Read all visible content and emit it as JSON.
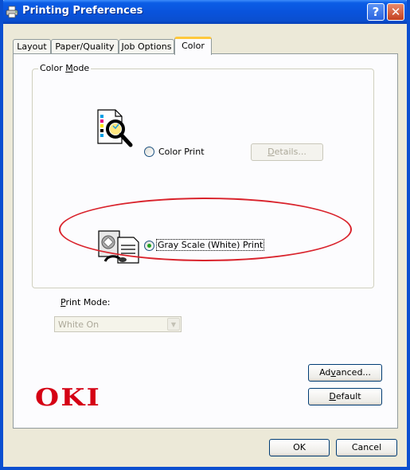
{
  "window": {
    "title": "Printing Preferences",
    "help_glyph": "?",
    "close_glyph": "✕"
  },
  "tabs": [
    {
      "label": "Layout"
    },
    {
      "label": "Paper/Quality"
    },
    {
      "label": "Job Options"
    },
    {
      "label": "Color",
      "active": true
    }
  ],
  "color_mode": {
    "group_label_pre": "Color ",
    "group_label_ul": "M",
    "group_label_post": "ode",
    "color_print": {
      "label": "Color Print",
      "checked": false
    },
    "details_button": {
      "pre": "",
      "ul": "D",
      "post": "etails...",
      "enabled": false
    },
    "grayscale_print": {
      "label": "Gray Scale (White) Print",
      "checked": true
    }
  },
  "print_mode": {
    "label_ul": "P",
    "label_post": "rint Mode:",
    "selected": "White On",
    "enabled": false
  },
  "buttons": {
    "advanced": {
      "pre": "Ad",
      "ul": "v",
      "post": "anced..."
    },
    "default": {
      "pre": "",
      "ul": "D",
      "post": "efault"
    },
    "ok": "OK",
    "cancel": "Cancel"
  },
  "brand": {
    "logo_text": "OKI",
    "color": "#d50014"
  },
  "colors": {
    "titlebar": "#0a4fd0",
    "dialog_bg": "#ece9d8",
    "tab_accent": "#ffc83c",
    "annotation": "#d9232c",
    "radio_dot": "#21a121"
  },
  "icons": {
    "title": "printer-icon",
    "color_print": "color-document-magnifier-icon",
    "grayscale_print": "grayscale-document-icon"
  }
}
